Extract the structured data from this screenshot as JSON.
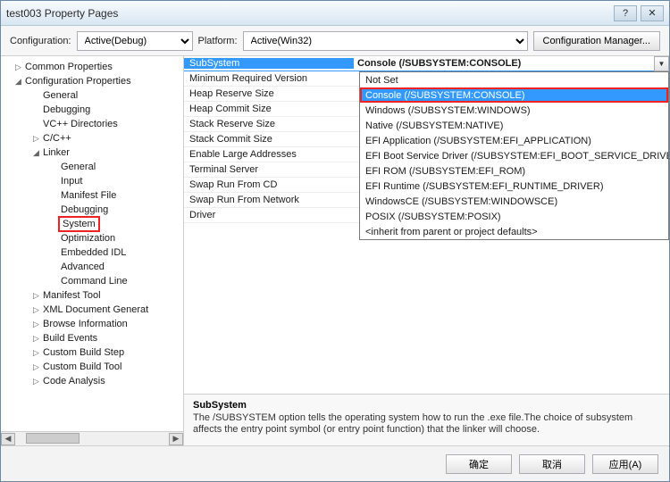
{
  "window": {
    "title": "test003 Property Pages"
  },
  "config": {
    "label_config": "Configuration:",
    "config_value": "Active(Debug)",
    "label_platform": "Platform:",
    "platform_value": "Active(Win32)",
    "manager_btn": "Configuration Manager..."
  },
  "tree": [
    {
      "lvl": 1,
      "toggle": "▷",
      "label": "Common Properties"
    },
    {
      "lvl": 1,
      "toggle": "◢",
      "label": "Configuration Properties"
    },
    {
      "lvl": 2,
      "toggle": "",
      "label": "General"
    },
    {
      "lvl": 2,
      "toggle": "",
      "label": "Debugging"
    },
    {
      "lvl": 2,
      "toggle": "",
      "label": "VC++ Directories"
    },
    {
      "lvl": 2,
      "toggle": "▷",
      "label": "C/C++"
    },
    {
      "lvl": 2,
      "toggle": "◢",
      "label": "Linker"
    },
    {
      "lvl": 3,
      "toggle": "",
      "label": "General"
    },
    {
      "lvl": 3,
      "toggle": "",
      "label": "Input"
    },
    {
      "lvl": 3,
      "toggle": "",
      "label": "Manifest File"
    },
    {
      "lvl": 3,
      "toggle": "",
      "label": "Debugging"
    },
    {
      "lvl": 3,
      "toggle": "",
      "label": "System",
      "hl": true
    },
    {
      "lvl": 3,
      "toggle": "",
      "label": "Optimization"
    },
    {
      "lvl": 3,
      "toggle": "",
      "label": "Embedded IDL"
    },
    {
      "lvl": 3,
      "toggle": "",
      "label": "Advanced"
    },
    {
      "lvl": 3,
      "toggle": "",
      "label": "Command Line"
    },
    {
      "lvl": 2,
      "toggle": "▷",
      "label": "Manifest Tool"
    },
    {
      "lvl": 2,
      "toggle": "▷",
      "label": "XML Document Generat"
    },
    {
      "lvl": 2,
      "toggle": "▷",
      "label": "Browse Information"
    },
    {
      "lvl": 2,
      "toggle": "▷",
      "label": "Build Events"
    },
    {
      "lvl": 2,
      "toggle": "▷",
      "label": "Custom Build Step"
    },
    {
      "lvl": 2,
      "toggle": "▷",
      "label": "Custom Build Tool"
    },
    {
      "lvl": 2,
      "toggle": "▷",
      "label": "Code Analysis"
    }
  ],
  "props": [
    {
      "name": "SubSystem",
      "val": "Console (/SUBSYSTEM:CONSOLE)",
      "selected": true
    },
    {
      "name": "Minimum Required Version",
      "val": ""
    },
    {
      "name": "Heap Reserve Size",
      "val": ""
    },
    {
      "name": "Heap Commit Size",
      "val": ""
    },
    {
      "name": "Stack Reserve Size",
      "val": ""
    },
    {
      "name": "Stack Commit Size",
      "val": ""
    },
    {
      "name": "Enable Large Addresses",
      "val": ""
    },
    {
      "name": "Terminal Server",
      "val": ""
    },
    {
      "name": "Swap Run From CD",
      "val": ""
    },
    {
      "name": "Swap Run From Network",
      "val": ""
    },
    {
      "name": "Driver",
      "val": ""
    }
  ],
  "dropdown": [
    "Not Set",
    "Console (/SUBSYSTEM:CONSOLE)",
    "Windows (/SUBSYSTEM:WINDOWS)",
    "Native (/SUBSYSTEM:NATIVE)",
    "EFI Application (/SUBSYSTEM:EFI_APPLICATION)",
    "EFI Boot Service Driver (/SUBSYSTEM:EFI_BOOT_SERVICE_DRIVER)",
    "EFI ROM (/SUBSYSTEM:EFI_ROM)",
    "EFI Runtime (/SUBSYSTEM:EFI_RUNTIME_DRIVER)",
    "WindowsCE (/SUBSYSTEM:WINDOWSCE)",
    "POSIX (/SUBSYSTEM:POSIX)",
    "<inherit from parent or project defaults>"
  ],
  "dropdown_selected_index": 1,
  "desc": {
    "title": "SubSystem",
    "text": "The /SUBSYSTEM option tells the operating system how to run the .exe file.The choice of subsystem affects the entry point symbol (or entry point function) that the linker will choose."
  },
  "footer": {
    "ok": "确定",
    "cancel": "取消",
    "apply": "应用(A)"
  }
}
